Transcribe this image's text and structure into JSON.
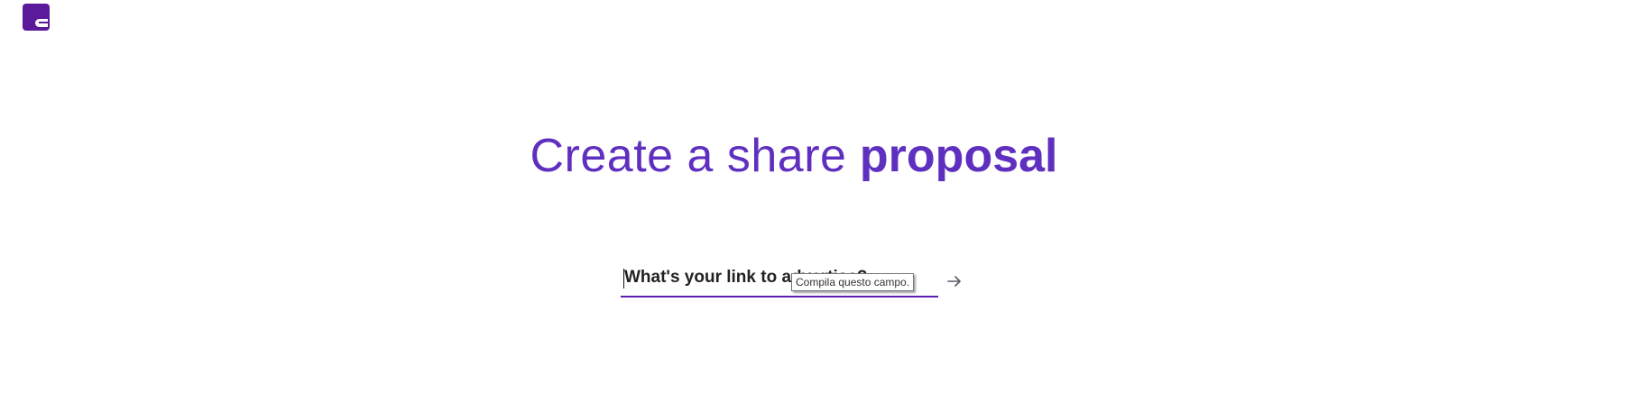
{
  "brand": {
    "logo_icon": "brand-logo-icon",
    "color": "#5b1a99"
  },
  "headline": {
    "light": "Create a share",
    "bold": "proposal",
    "color": "#5f2fbf"
  },
  "form": {
    "link_placeholder": "What's your link to advertise?",
    "link_value": "",
    "submit_icon": "arrow-right-icon",
    "validation_tooltip": "Compila questo campo.",
    "underline_color": "#5b1db3"
  }
}
